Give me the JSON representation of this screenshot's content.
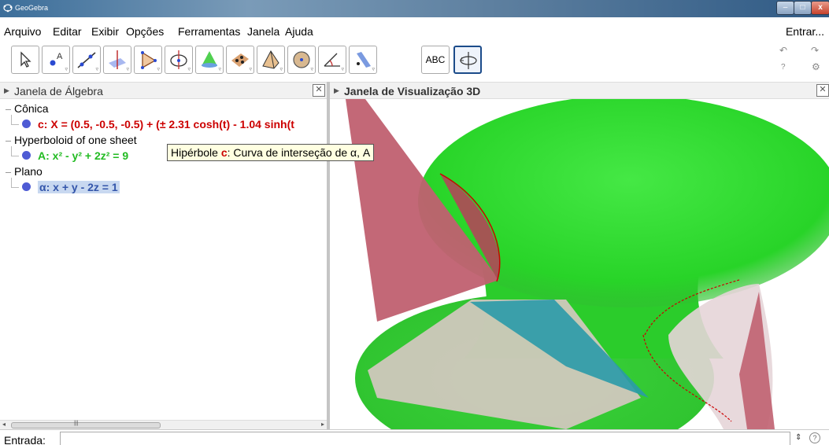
{
  "window": {
    "title": "GeoGebra",
    "controls": {
      "minimize": "–",
      "maximize": "□",
      "close": "x"
    }
  },
  "menu": {
    "items": [
      "Arquivo",
      "Editar",
      "Exibir",
      "Opções",
      "Ferramentas",
      "Janela",
      "Ajuda"
    ],
    "signin": "Entrar..."
  },
  "toolbar": {
    "tools": [
      {
        "icon": "pointer-icon"
      },
      {
        "icon": "point-icon"
      },
      {
        "icon": "line-icon"
      },
      {
        "icon": "perpendicular-line-icon"
      },
      {
        "icon": "polygon-icon"
      },
      {
        "icon": "circle-axis-icon"
      },
      {
        "icon": "intersect-surfaces-icon"
      },
      {
        "icon": "plane-points-icon"
      },
      {
        "icon": "pyramid-icon"
      },
      {
        "icon": "sphere-icon"
      },
      {
        "icon": "angle-icon"
      },
      {
        "icon": "reflect-plane-icon"
      },
      {
        "icon": "text-icon",
        "label": "ABC"
      },
      {
        "icon": "rotate-3d-view-icon",
        "selected": true
      }
    ],
    "undo": "↶",
    "redo": "↷",
    "help": "?",
    "settings": "⚙"
  },
  "algebra": {
    "title": "Janela de Álgebra",
    "close": "✕",
    "categories": [
      {
        "name": "Cônica",
        "objects": [
          {
            "text": "c: X = (0.5, -0.5, -0.5) + (± 2.31 cosh(t) - 1.04 sinh(t",
            "color": "#cc0000"
          }
        ]
      },
      {
        "name": "Hyperboloid of one sheet",
        "objects": [
          {
            "text": "A: x² - y² + 2z² = 9",
            "color": "#22bb22"
          }
        ]
      },
      {
        "name": "Plano",
        "objects": [
          {
            "text": "α: x + y - 2z = 1",
            "color": "#3355aa",
            "selected": true
          }
        ]
      }
    ]
  },
  "view3d": {
    "title": "Janela de Visualização 3D",
    "close": "✕"
  },
  "tooltip": {
    "prefix": "Hipérbole ",
    "name": "c",
    "suffix": ": Curva de interseção de α, A"
  },
  "input": {
    "label": "Entrada:",
    "value": "",
    "stepper": "⇕",
    "help": "?"
  },
  "colors": {
    "hyperboloid": "#2ecc2e",
    "plane": "#c06070",
    "conic": "#cc0000",
    "selection": "#c8d8f0"
  }
}
